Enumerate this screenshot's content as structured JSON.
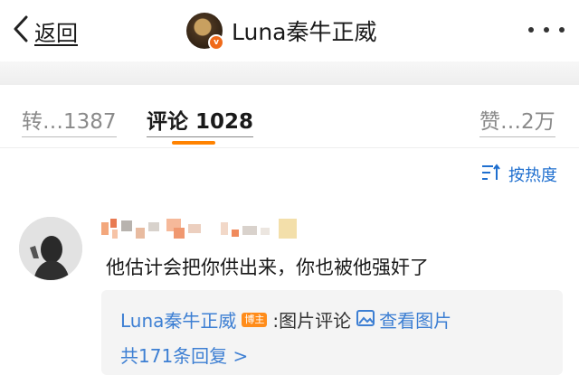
{
  "nav": {
    "back_label": "返回",
    "title": "Luna秦牛正威",
    "verified_mark": "v",
    "back_icon": "chevron-left-icon",
    "more_icon": "more-horizontal-icon"
  },
  "tabs": [
    {
      "label": "转…1387",
      "active": false
    },
    {
      "label": "评论 1028",
      "active": true
    },
    {
      "label": "赞…2万",
      "active": false
    }
  ],
  "sort": {
    "label": "按热度",
    "icon": "sort-icon"
  },
  "comment": {
    "text": "他估计会把你供出来，你也被他强奸了",
    "reply": {
      "author": "Luna秦牛正威",
      "badge": "博主",
      "text": ":图片评论",
      "view_image_label": "查看图片",
      "more_replies_label": "共171条回复 >"
    }
  },
  "colors": {
    "accent": "#ff8200",
    "link": "#3d7fd3",
    "badge": "#ff8c1a"
  }
}
